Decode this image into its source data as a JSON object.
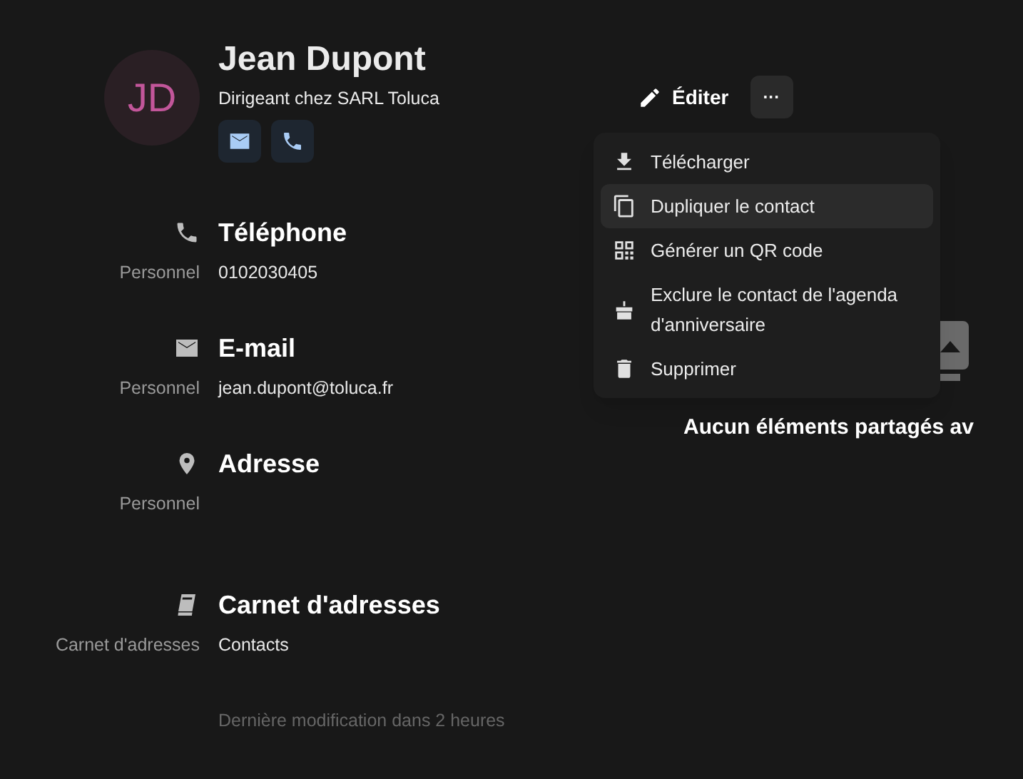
{
  "contact": {
    "initials": "JD",
    "name": "Jean Dupont",
    "subtitle": "Dirigeant chez SARL Toluca",
    "quick_actions": [
      {
        "kind": "email"
      },
      {
        "kind": "phone"
      }
    ]
  },
  "toolbar": {
    "edit_label": "Éditer",
    "more_label": "···"
  },
  "menu": {
    "items": [
      {
        "kind": "download",
        "label": "Télécharger",
        "selected": false
      },
      {
        "kind": "copy",
        "label": "Dupliquer le contact",
        "selected": true
      },
      {
        "kind": "qr",
        "label": "Générer un QR code",
        "selected": false
      },
      {
        "kind": "cake",
        "label": "Exclure le contact de l'agenda d'anniversaire",
        "selected": false
      },
      {
        "kind": "trash",
        "label": "Supprimer",
        "selected": false
      }
    ]
  },
  "sections": [
    {
      "kind": "phone",
      "title": "Téléphone",
      "fields": [
        {
          "label": "Personnel",
          "value": "0102030405"
        }
      ]
    },
    {
      "kind": "email",
      "title": "E-mail",
      "fields": [
        {
          "label": "Personnel",
          "value": "jean.dupont@toluca.fr"
        }
      ]
    },
    {
      "kind": "address",
      "title": "Adresse",
      "fields": [
        {
          "label": "Personnel"
        }
      ]
    },
    {
      "kind": "book",
      "title": "Carnet d'adresses",
      "fields": [
        {
          "label": "Carnet d'adresses",
          "value": "Contacts"
        }
      ]
    }
  ],
  "footer": "Dernière modification dans 2 heures",
  "shared": {
    "message": "Aucun éléments partagés av"
  }
}
